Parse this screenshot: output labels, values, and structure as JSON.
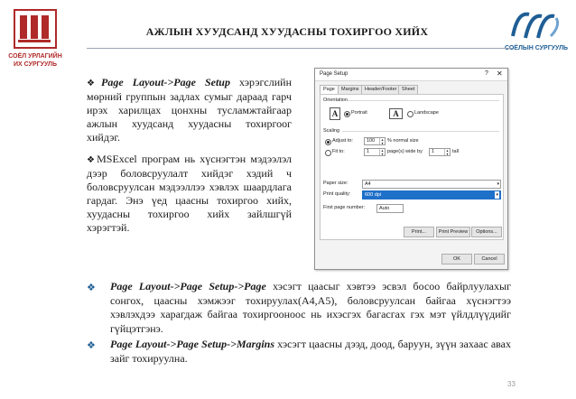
{
  "header": {
    "title": "АЖЛЫН ХУУДСАНД ХУУДАСНЫ ТОХИРГОО ХИЙХ",
    "logo_left_text": [
      "СОЁЛ УРЛАГИЙН",
      "ИХ СУРГУУЛЬ"
    ],
    "logo_right_text": "СОЁЛЫН СУРГУУЛЬ"
  },
  "left_paras": {
    "p1_bullet": "❖",
    "p1_emph": "Page Layout->Page Setup",
    "p1_rest": " хэрэгслийн мөрний группын задлах сумыг дараад гарч ирэх харилцах цонхны тусламжтайгаар ажлын хуудсанд хуудасны тохиргоог хийдэг.",
    "p2_bullet": "❖",
    "p2_text": "MSExcel програм нь хүснэгтэн мэдээлэл дээр боловсруулалт хийдэг хэдий ч боловсруулсан мэдээллээ хэвлэх шаардлага гардаг. Энэ үед цаасны тохиргоо хийх, хуудасны тохиргоо хийх зайлшгүй хэрэгтэй."
  },
  "bullets": [
    {
      "mark": "❖",
      "emph": "Page Layout->Page Setup->Page",
      "rest": " хэсэгт цаасыг хэвтээ эсвэл босоо байрлуулахыг сонгох, цаасны хэмжээг тохируулах(А4,А5), боловсруулсан байгаа хүснэгтээ хэвлэхдээ харагдаж байгаа тохиргооноос нь ихэсгэх багасгах гэх мэт үйлдлүүдийг гүйцэтгэнэ."
    },
    {
      "mark": "❖",
      "emph": "Page Layout->Page Setup->Margins",
      "rest": " хэсэгт цаасны дээд, доод, баруун, зүүн захаас авах зайг тохируулна."
    }
  ],
  "page_number": "33",
  "dialog": {
    "title": "Page Setup",
    "help": "?",
    "close": "✕",
    "tabs": [
      "Page",
      "Margins",
      "Header/Footer",
      "Sheet"
    ],
    "orientation_label": "Orientation",
    "portrait": "Portrait",
    "landscape": "Landscape",
    "scaling_label": "Scaling",
    "adjust_to": "Adjust to:",
    "adjust_value": "100",
    "adjust_suffix": "% normal size",
    "fit_to": "Fit to:",
    "fit_w": "1",
    "fit_mid": "page(s) wide by",
    "fit_h": "1",
    "fit_tall": "tall",
    "paper_size_label": "Paper size:",
    "paper_size": "A4",
    "print_quality_label": "Print quality:",
    "print_quality": "600 dpi",
    "first_page_label": "First page number:",
    "first_page": "Auto",
    "btn_print": "Print...",
    "btn_preview": "Print Preview",
    "btn_options": "Options...",
    "btn_ok": "OK",
    "btn_cancel": "Cancel"
  }
}
